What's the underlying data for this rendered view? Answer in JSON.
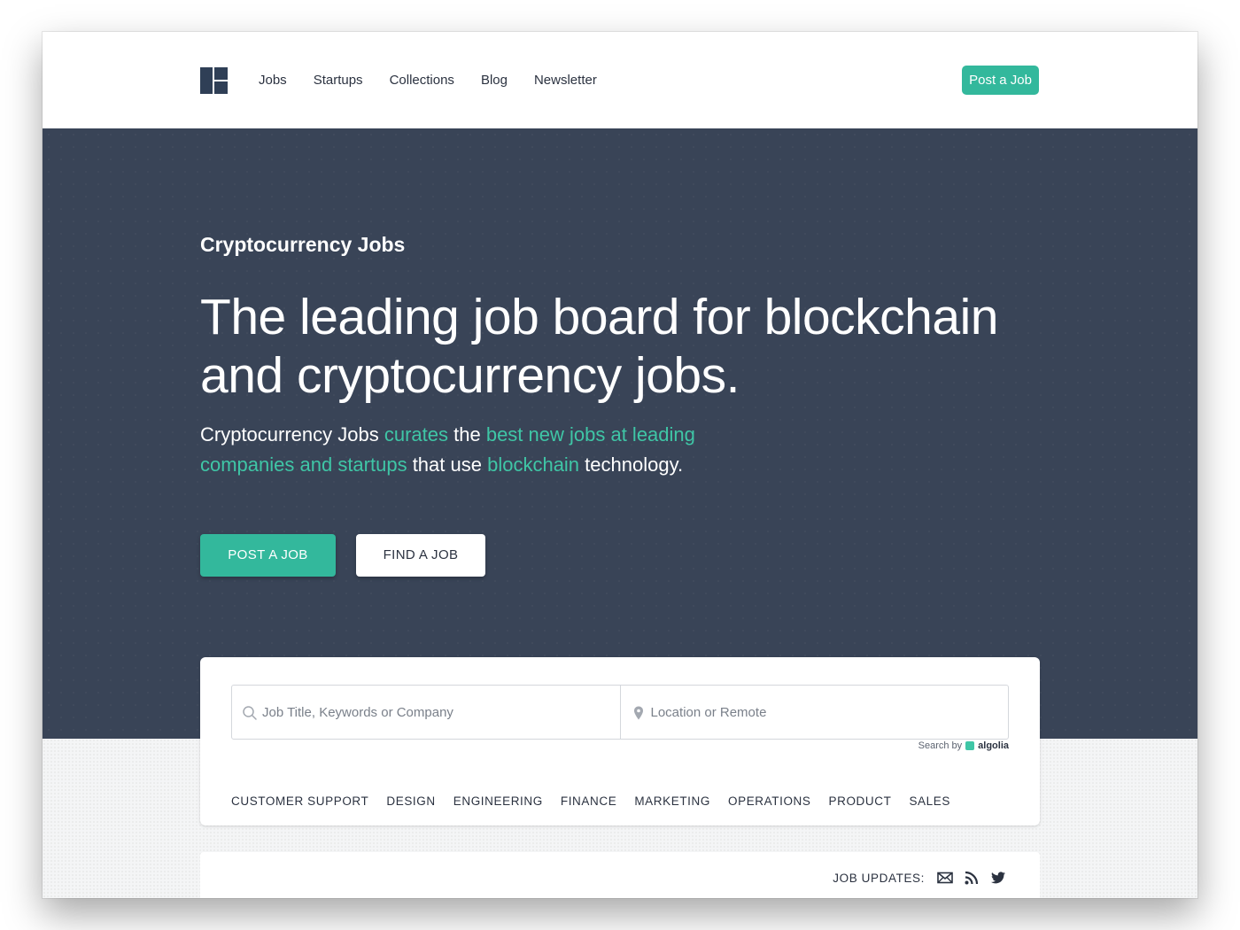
{
  "nav": {
    "links": [
      "Jobs",
      "Startups",
      "Collections",
      "Blog",
      "Newsletter"
    ],
    "post_job": "Post a Job"
  },
  "hero": {
    "eyebrow": "Cryptocurrency Jobs",
    "title": "The leading job board for blockchain and cryptocurrency jobs.",
    "sub": {
      "p1": "Cryptocurrency Jobs ",
      "h1": "curates",
      "p2": " the ",
      "h2": "best new jobs at leading companies and startups",
      "p3": " that use ",
      "h3": "blockchain",
      "p4": " technology."
    },
    "btn_post": "POST A JOB",
    "btn_find": "FIND A JOB"
  },
  "search": {
    "keywords_placeholder": "Job Title, Keywords or Company",
    "location_placeholder": "Location or Remote",
    "powered_by": "Search by",
    "provider": "algolia"
  },
  "categories": [
    "CUSTOMER SUPPORT",
    "DESIGN",
    "ENGINEERING",
    "FINANCE",
    "MARKETING",
    "OPERATIONS",
    "PRODUCT",
    "SALES"
  ],
  "updates": {
    "label": "JOB UPDATES:",
    "icons": [
      "email-icon",
      "rss-icon",
      "twitter-icon"
    ]
  },
  "colors": {
    "accent": "#33b89c",
    "highlight": "#3fc6a6",
    "hero_bg": "#394457",
    "logo": "#2f3f56"
  }
}
